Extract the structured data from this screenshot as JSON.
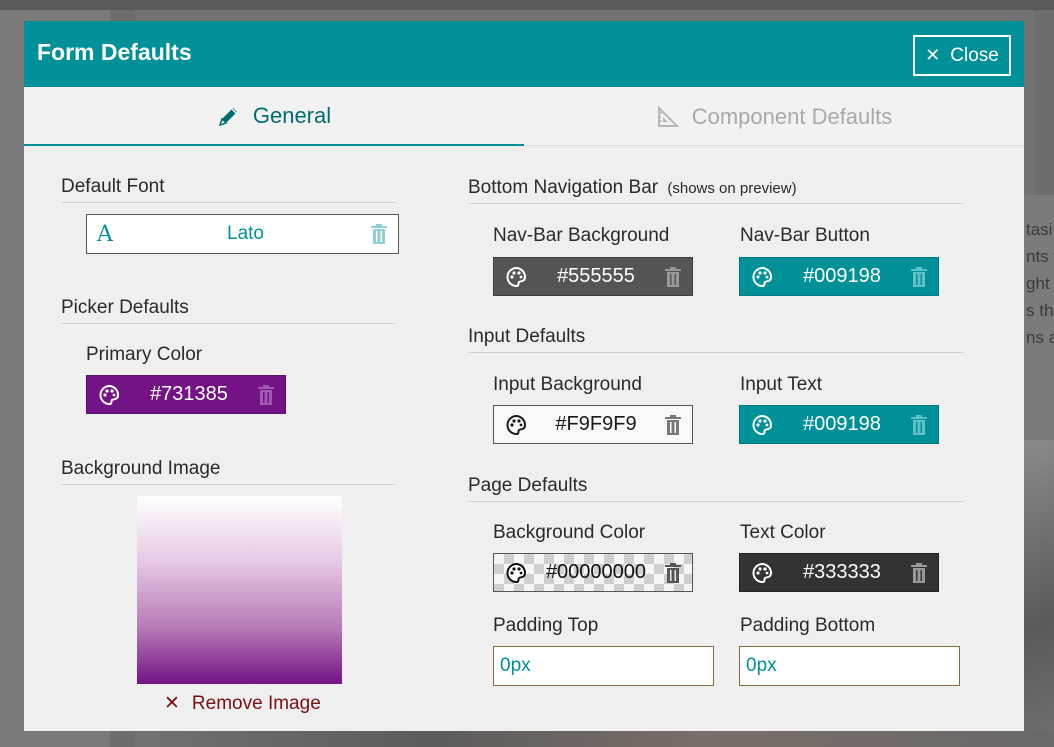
{
  "background": {
    "partial_text": [
      "tasi",
      "nts t",
      "ght",
      "s th",
      "ns a"
    ]
  },
  "modal": {
    "title": "Form Defaults",
    "close_label": "Close"
  },
  "tabs": [
    {
      "label": "General",
      "icon": "pencil-icon",
      "active": true
    },
    {
      "label": "Component Defaults",
      "icon": "ruler-triangle-icon",
      "active": false
    }
  ],
  "left": {
    "default_font": {
      "title": "Default Font",
      "value": "Lato"
    },
    "picker_defaults": {
      "title": "Picker Defaults",
      "primary_color_label": "Primary Color",
      "primary_color": "#731385"
    },
    "background_image": {
      "title": "Background Image",
      "remove_label": "Remove Image"
    }
  },
  "right": {
    "bottom_nav": {
      "title": "Bottom Navigation Bar",
      "subtitle": "(shows on preview)",
      "bg_label": "Nav-Bar Background",
      "bg_value": "#555555",
      "btn_label": "Nav-Bar Button",
      "btn_value": "#009198"
    },
    "input_defaults": {
      "title": "Input Defaults",
      "bg_label": "Input Background",
      "bg_value": "#F9F9F9",
      "text_label": "Input Text",
      "text_value": "#009198"
    },
    "page_defaults": {
      "title": "Page Defaults",
      "bg_label": "Background Color",
      "bg_value": "#00000000",
      "text_label": "Text Color",
      "text_value": "#333333",
      "pad_top_label": "Padding Top",
      "pad_top_value": "0px",
      "pad_bottom_label": "Padding Bottom",
      "pad_bottom_value": "0px"
    }
  },
  "colors": {
    "accent": "#009198",
    "primary": "#731385",
    "dark_gray": "#555555",
    "text_dark": "#333333",
    "remove_red": "#7a1010"
  }
}
